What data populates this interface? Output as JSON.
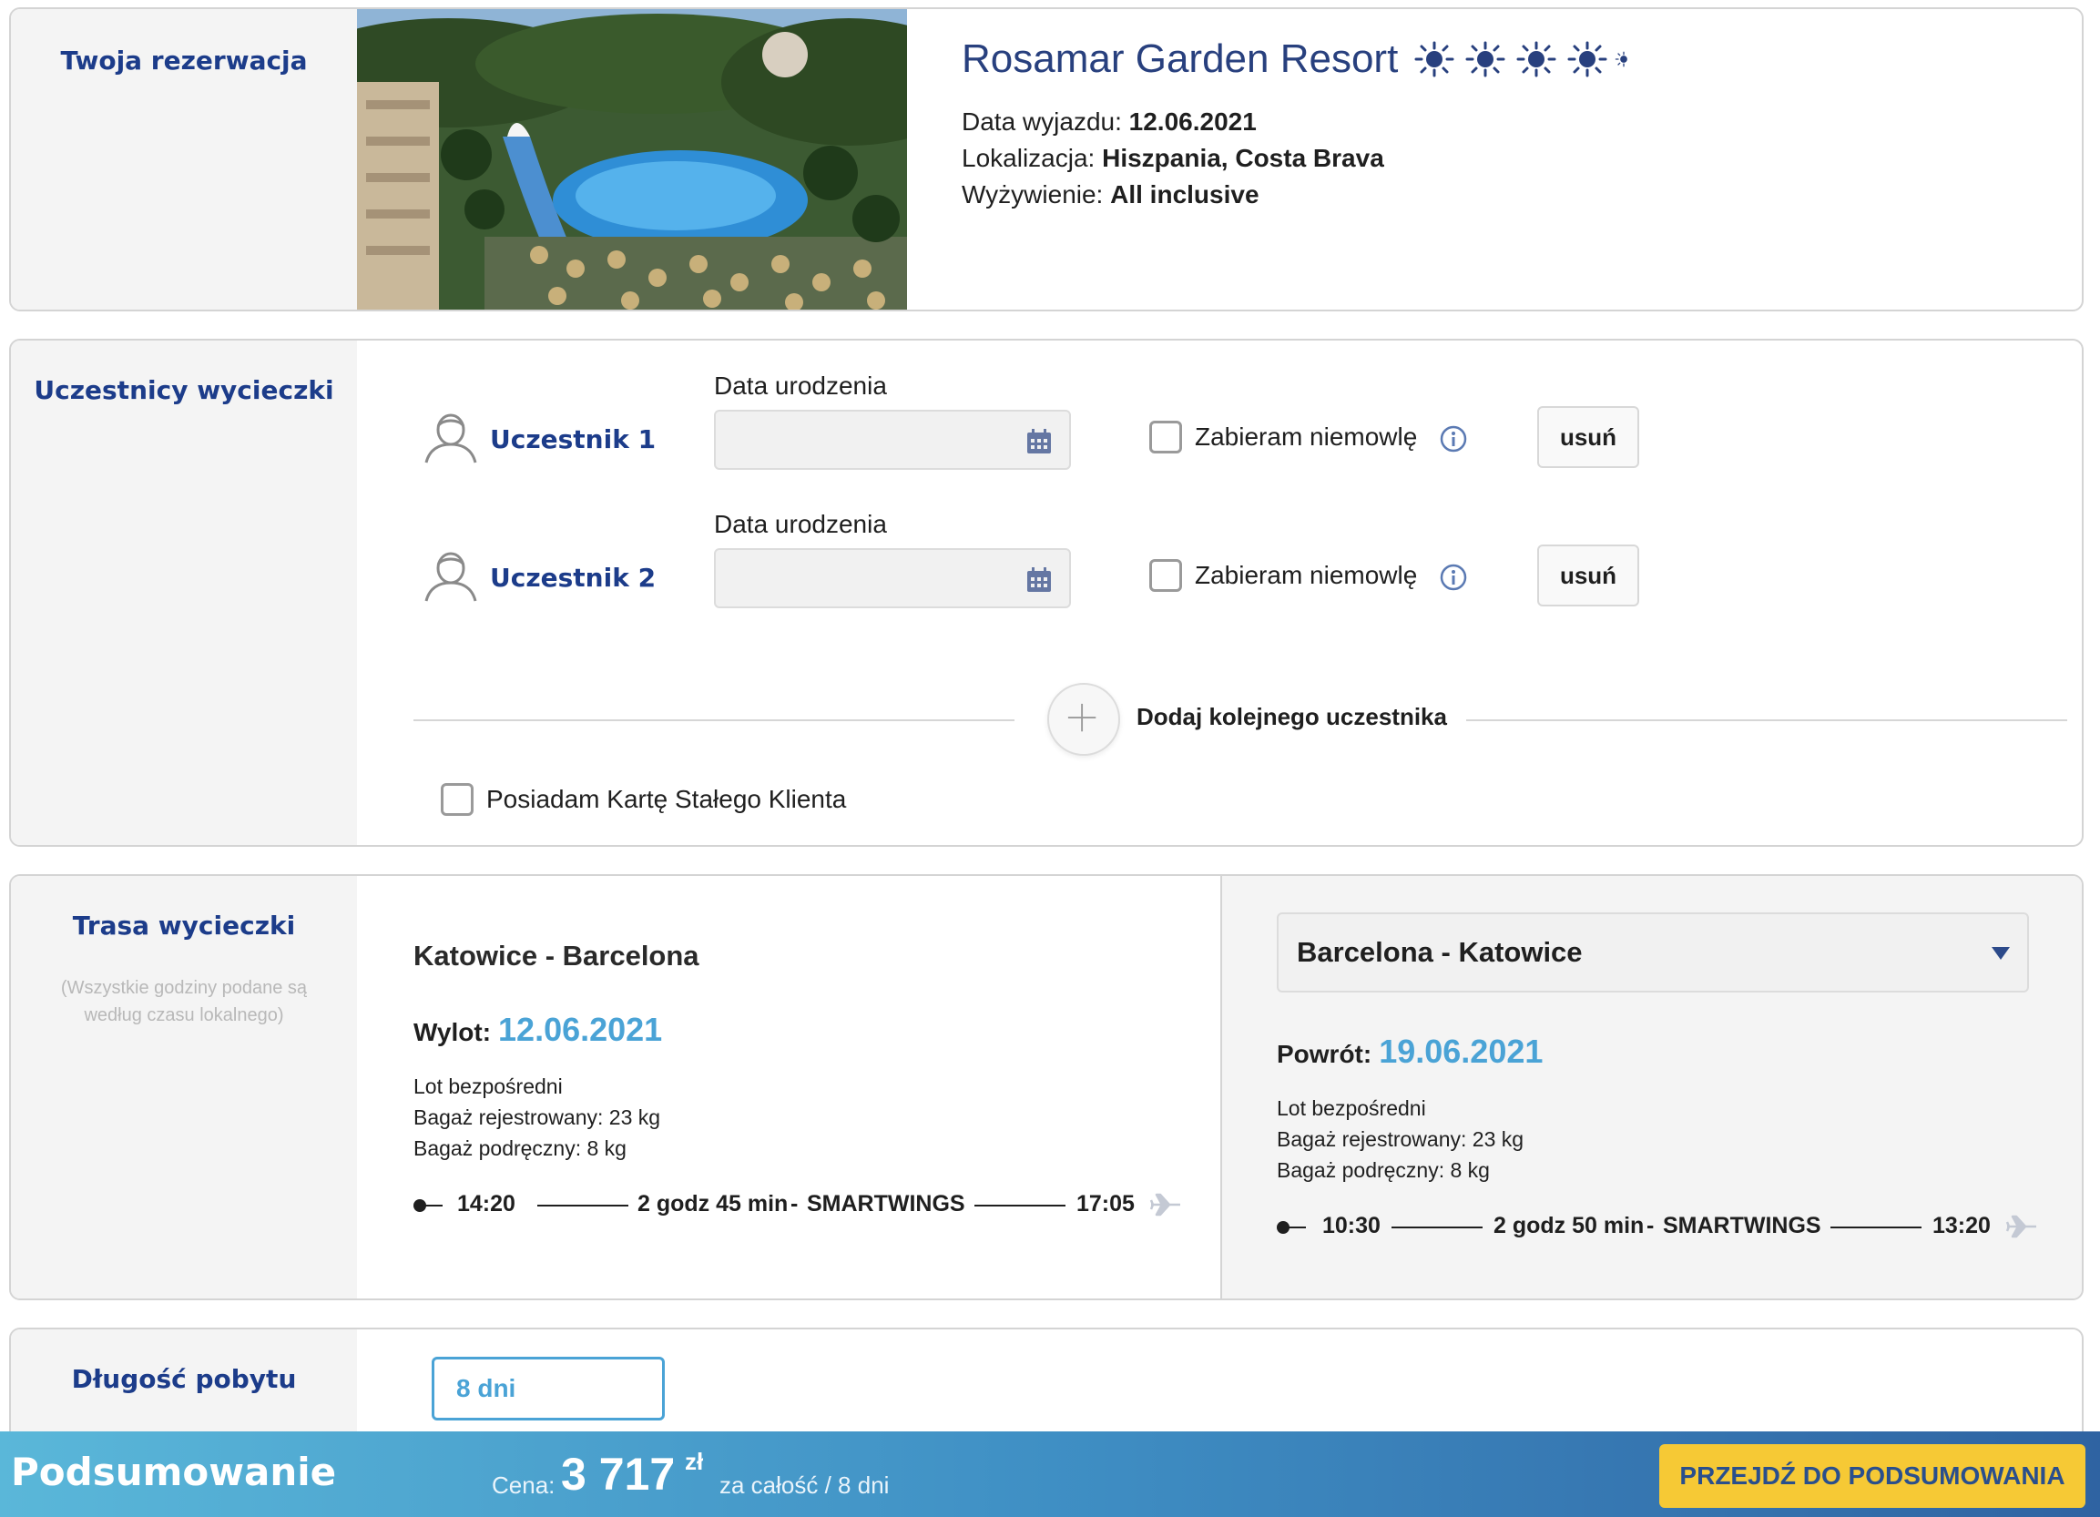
{
  "booking": {
    "section_title": "Twoja rezerwacja",
    "hotel_name": "Rosamar Garden Resort",
    "star_icon": "sun-icon",
    "departure_label": "Data wyjazdu:",
    "departure_value": "12.06.2021",
    "location_label": "Lokalizacja:",
    "location_value": "Hiszpania, Costa Brava",
    "board_label": "Wyżywienie:",
    "board_value": "All inclusive"
  },
  "participants": {
    "section_title": "Uczestnicy wycieczki",
    "items": [
      {
        "name": "Uczestnik 1",
        "dob_label": "Data urodzenia",
        "dob_value": "",
        "infant_label": "Zabieram niemowlę",
        "infant_checked": false,
        "remove_label": "usuń"
      },
      {
        "name": "Uczestnik 2",
        "dob_label": "Data urodzenia",
        "dob_value": "",
        "infant_label": "Zabieram niemowlę",
        "infant_checked": false,
        "remove_label": "usuń"
      }
    ],
    "add_label": "Dodaj kolejnego uczestnika",
    "loyalty_label": "Posiadam Kartę Stałego Klienta",
    "loyalty_checked": false
  },
  "route": {
    "section_title": "Trasa wycieczki",
    "note": "(Wszystkie godziny podane są według czasu lokalnego)",
    "outbound": {
      "title": "Katowice - Barcelona",
      "date_label": "Wylot:",
      "date_value": "12.06.2021",
      "flight_type": "Lot bezpośredni",
      "checked_baggage": "Bagaż rejestrowany: 23 kg",
      "hand_baggage": "Bagaż podręczny: 8 kg",
      "depart_time": "14:20",
      "duration": "2 godz 45 min",
      "separator": "-",
      "airline": "SMARTWINGS",
      "arrive_time": "17:05"
    },
    "return": {
      "title": "Barcelona - Katowice",
      "date_label": "Powrót:",
      "date_value": "19.06.2021",
      "flight_type": "Lot bezpośredni",
      "checked_baggage": "Bagaż rejestrowany: 23 kg",
      "hand_baggage": "Bagaż podręczny: 8 kg",
      "depart_time": "10:30",
      "duration": "2 godz 50 min",
      "separator": "-",
      "airline": "SMARTWINGS",
      "arrive_time": "13:20"
    }
  },
  "stay": {
    "section_title": "Długość pobytu",
    "value": "8 dni"
  },
  "summary": {
    "title": "Podsumowanie",
    "price_label": "Cena:",
    "price_value": "3 717",
    "currency": "zł",
    "price_note": "za całość / 8 dni",
    "cta_label": "PRZEJDŹ DO PODSUMOWANIA"
  },
  "colors": {
    "brand_navy": "#1c3c8a",
    "accent_blue": "#4aa3d6",
    "cta_yellow": "#f6c935"
  }
}
